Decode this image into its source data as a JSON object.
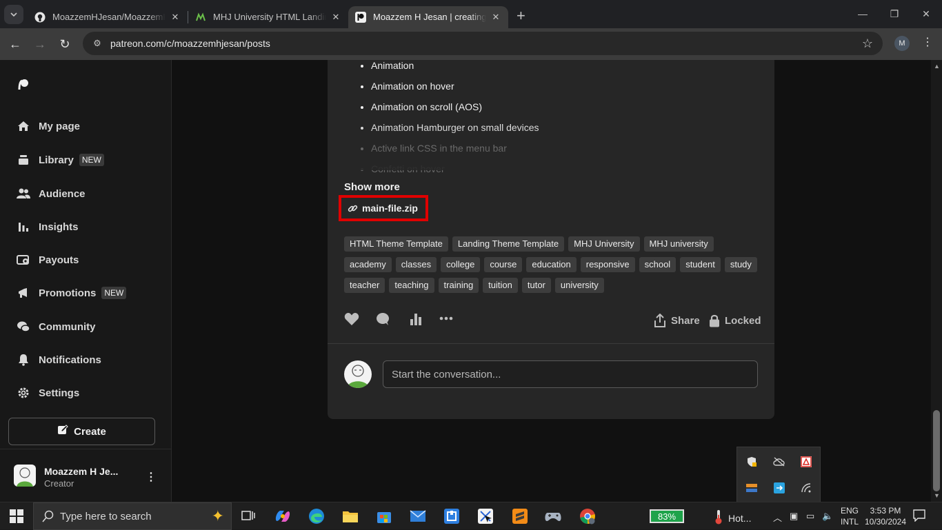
{
  "browser": {
    "tabs": [
      {
        "title": "MoazzemHJesan/MoazzemHJesan",
        "active": false
      },
      {
        "title": "MHJ University HTML Landing Page",
        "active": false
      },
      {
        "title": "Moazzem H Jesan | creating web",
        "active": true
      }
    ],
    "url": "patreon.com/c/moazzemhjesan/posts",
    "profile_initial": "M"
  },
  "sidebar": {
    "items": [
      {
        "label": "My page",
        "icon": "home-icon"
      },
      {
        "label": "Library",
        "icon": "library-icon",
        "badge": "NEW"
      },
      {
        "label": "Audience",
        "icon": "audience-icon"
      },
      {
        "label": "Insights",
        "icon": "insights-icon"
      },
      {
        "label": "Payouts",
        "icon": "payouts-icon"
      },
      {
        "label": "Promotions",
        "icon": "megaphone-icon",
        "badge": "NEW"
      },
      {
        "label": "Community",
        "icon": "community-icon"
      },
      {
        "label": "Notifications",
        "icon": "bell-icon"
      },
      {
        "label": "Settings",
        "icon": "gear-icon"
      }
    ],
    "create_label": "Create",
    "user": {
      "name": "Moazzem H Je...",
      "role": "Creator"
    }
  },
  "post": {
    "features": [
      "Animation",
      "Animation on hover",
      "Animation on scroll (AOS)",
      "Animation Hamburger on small devices",
      "Active link CSS in the menu bar",
      "Confetti on hover"
    ],
    "show_more": "Show more",
    "attachment": "main-file.zip",
    "tags": [
      "HTML Theme Template",
      "Landing Theme Template",
      "MHJ University",
      "MHJ university",
      "academy",
      "classes",
      "college",
      "course",
      "education",
      "responsive",
      "school",
      "student",
      "study",
      "teacher",
      "teaching",
      "training",
      "tuition",
      "tutor",
      "university"
    ],
    "share_label": "Share",
    "locked_label": "Locked",
    "comment_placeholder": "Start the conversation..."
  },
  "taskbar": {
    "search_placeholder": "Type here to search",
    "battery": "83%",
    "weather": "Hot...",
    "lang_top": "ENG",
    "lang_bottom": "INTL",
    "time": "3:53 PM",
    "date": "10/30/2024"
  },
  "colors": {
    "highlight": "#e00000",
    "accent_green": "#1ea34a"
  }
}
